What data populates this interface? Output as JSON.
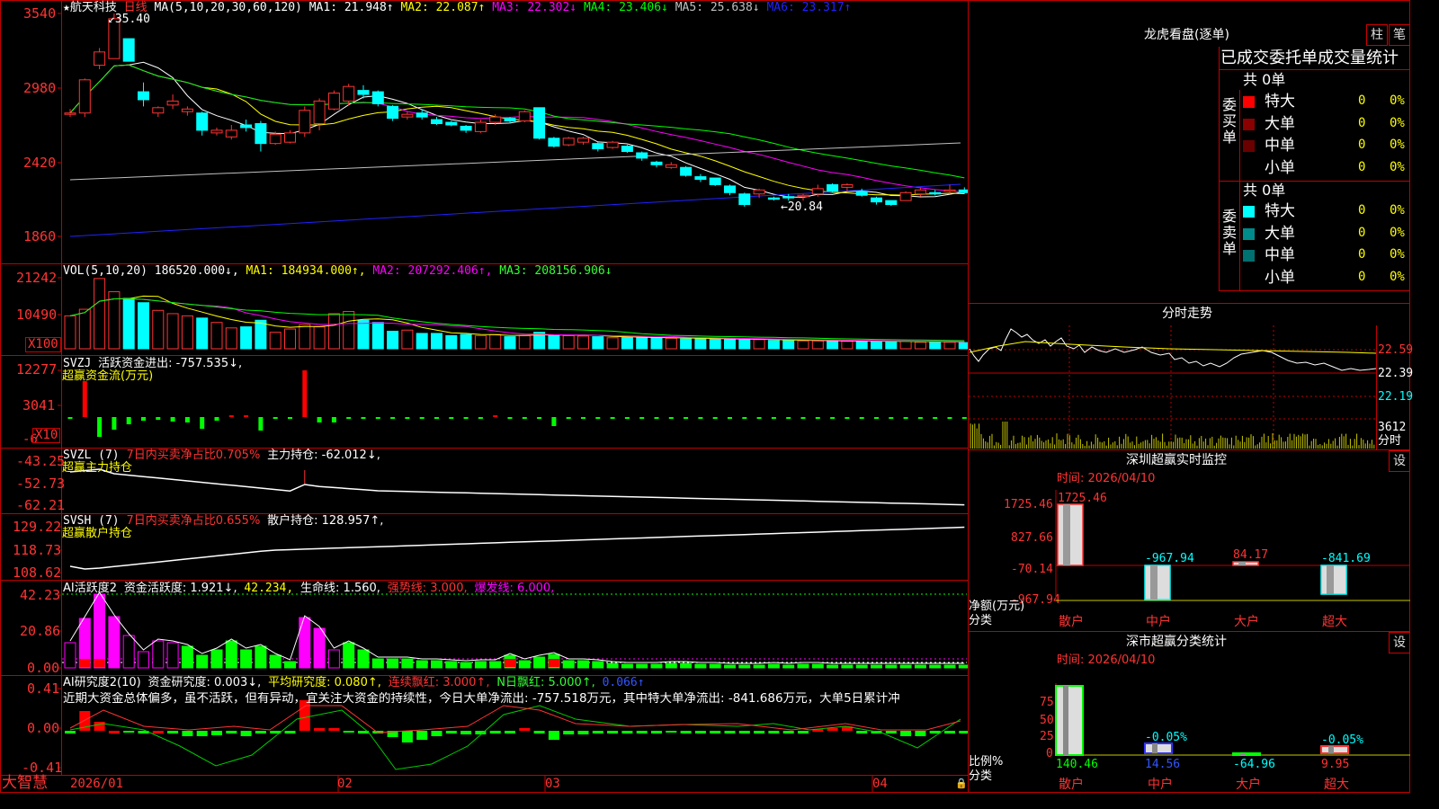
{
  "stock": {
    "name": "航天科技",
    "period": "日线",
    "ma_label": "MA(5,10,20,30,60,120)"
  },
  "ma_values": [
    {
      "label": "MA1: 21.948↑",
      "color": "#ffffff"
    },
    {
      "label": "MA2: 22.087↑",
      "color": "#ffff00"
    },
    {
      "label": "MA3: 22.302↓",
      "color": "#ff00ff"
    },
    {
      "label": "MA4: 23.406↓",
      "color": "#00ff00"
    },
    {
      "label": "MA5: 25.638↓",
      "color": "#c0c0c0"
    },
    {
      "label": "MA6: 23.317↑",
      "color": "#2222ff"
    }
  ],
  "price_axis": [
    "3540",
    "2980",
    "2420",
    "1860"
  ],
  "price_high_mark": "35.40",
  "price_low_mark": "←20.84",
  "vol": {
    "title": "VOL(5,10,20)",
    "value": "186520.000↓",
    "ma1": "MA1: 184934.000↑",
    "ma2": "MA2: 207292.406↑",
    "ma3": "MA3: 208156.906↓",
    "axis": [
      "21242",
      "10490"
    ],
    "unit": "X100"
  },
  "svzj": {
    "title": "SVZJ",
    "desc": "活跃资金进出: -757.535↓,",
    "subtitle": "超赢资金流(万元)",
    "axis": [
      "12277",
      "3041",
      "-6"
    ],
    "unit": "X10"
  },
  "svzl": {
    "title": "SVZL (7)",
    "desc_red": "7日内买卖净占比0.705%",
    "desc": "主力持仓: -62.012↓,",
    "subtitle": "超赢主力持仓",
    "axis": [
      "-43.25",
      "-52.73",
      "-62.21"
    ]
  },
  "svsh": {
    "title": "SVSH (7)",
    "desc_red": "7日内买卖净占比0.655%",
    "desc": "散户持仓: 128.957↑,",
    "subtitle": "超赢散户持仓",
    "axis": [
      "129.22",
      "118.73",
      "108.62"
    ]
  },
  "ai_active": {
    "title": "AI活跃度2",
    "active": "资金活跃度: 1.921↓,",
    "v2": "42.234,",
    "life": "生命线: 1.560,",
    "strong": "强势线: 3.000,",
    "burst": "爆发线: 6.000,",
    "axis": [
      "42.23",
      "20.86",
      "0.00"
    ]
  },
  "ai_research": {
    "title": "AI研究度2(10)",
    "research": "资金研究度: 0.003↓,",
    "avg": "平均研究度: 0.080↑,",
    "cont": "连续飘红: 3.000↑,",
    "nday": "N日飘红: 5.000↑,",
    "v5": "0.066↑",
    "axis": [
      "0.41",
      "0.00",
      "-0.41"
    ],
    "comment": "近期大资金总体偏多，虽不活跃，但有异动，宜关注大资金的持续性，今日大单净流出: -757.518万元，其中特大单净流出: -841.686万元，大单5日累计冲"
  },
  "dates": [
    "2026/01",
    "02",
    "03",
    "04"
  ],
  "brand": "大智慧",
  "lhb": {
    "title": "龙虎看盘(逐单)",
    "btn1": "柱",
    "btn2": "笔",
    "header": "已成交委托单成交量统计",
    "buy": {
      "side": "委买单",
      "total": "共 0单",
      "rows": [
        {
          "label": "特大",
          "qty": "0",
          "pct": "0%",
          "color": "#ff0000"
        },
        {
          "label": "大单",
          "qty": "0",
          "pct": "0%",
          "color": "#8b0000"
        },
        {
          "label": "中单",
          "qty": "0",
          "pct": "0%",
          "color": "#6b0000"
        },
        {
          "label": "小单",
          "qty": "0",
          "pct": "0%",
          "color": "#000000"
        }
      ]
    },
    "sell": {
      "side": "委卖单",
      "total": "共 0单",
      "rows": [
        {
          "label": "特大",
          "qty": "0",
          "pct": "0%",
          "color": "#00ffff"
        },
        {
          "label": "大单",
          "qty": "0",
          "pct": "0%",
          "color": "#008b8b"
        },
        {
          "label": "中单",
          "qty": "0",
          "pct": "0%",
          "color": "#007070"
        },
        {
          "label": "小单",
          "qty": "0",
          "pct": "0%",
          "color": "#000000"
        }
      ]
    }
  },
  "intraday": {
    "title": "分时走势",
    "axis": [
      "22.59",
      "22.39",
      "22.19"
    ],
    "vol": "3612",
    "unit": "分时"
  },
  "sz_monitor": {
    "title": "深圳超赢实时监控",
    "btn": "设",
    "time": "时间: 2026/04/10",
    "axis": [
      "1725.46",
      "827.66",
      "-70.14",
      "-967.94"
    ],
    "ylabel": "净额(万元)",
    "xlabel": "分类",
    "cats": [
      "散户",
      "中户",
      "大户",
      "超大"
    ],
    "values": [
      "1725.46",
      "-967.94",
      "84.17",
      "-841.69"
    ]
  },
  "sz_class": {
    "title": "深市超赢分类统计",
    "btn": "设",
    "time": "时间: 2026/04/10",
    "axis": [
      "75",
      "50",
      "25",
      "0"
    ],
    "ylabel": "比例%",
    "xlabel": "分类",
    "cats": [
      "散户",
      "中户",
      "大户",
      "超大"
    ],
    "pcts": [
      "",
      "-0.05%",
      "",
      "-0.05%"
    ],
    "values": [
      "140.46",
      "14.56",
      "-64.96",
      "9.95"
    ]
  },
  "chart_data": {
    "type": "candlestick",
    "title": "航天科技 日线",
    "candles": [
      [
        27.8,
        28.2,
        27.6,
        27.9
      ],
      [
        27.9,
        30.5,
        27.6,
        30.4
      ],
      [
        31.5,
        32.8,
        31.2,
        32.5
      ],
      [
        32.0,
        35.4,
        32.0,
        35.0
      ],
      [
        33.5,
        33.5,
        31.8,
        31.8
      ],
      [
        29.5,
        30.2,
        28.4,
        28.9
      ],
      [
        27.9,
        28.4,
        27.6,
        28.3
      ],
      [
        28.5,
        29.3,
        28.2,
        28.8
      ],
      [
        28.0,
        28.4,
        27.7,
        28.2
      ],
      [
        27.9,
        28.0,
        26.2,
        26.6
      ],
      [
        26.4,
        26.8,
        26.2,
        26.6
      ],
      [
        26.1,
        27.0,
        25.9,
        26.6
      ],
      [
        27.0,
        27.4,
        26.5,
        26.8
      ],
      [
        27.1,
        27.3,
        25.0,
        25.6
      ],
      [
        25.6,
        26.5,
        25.5,
        26.3
      ],
      [
        25.7,
        26.6,
        25.6,
        26.4
      ],
      [
        26.4,
        28.4,
        26.1,
        28.1
      ],
      [
        27.1,
        29.0,
        26.6,
        28.8
      ],
      [
        28.2,
        29.6,
        28.1,
        29.4
      ],
      [
        28.8,
        30.1,
        28.5,
        29.9
      ],
      [
        29.6,
        30.0,
        29.0,
        29.3
      ],
      [
        29.5,
        29.6,
        28.4,
        28.6
      ],
      [
        28.4,
        28.5,
        27.3,
        27.5
      ],
      [
        27.6,
        28.0,
        27.4,
        27.8
      ],
      [
        27.9,
        28.2,
        27.4,
        27.6
      ],
      [
        27.4,
        27.6,
        27.0,
        27.1
      ],
      [
        27.2,
        27.3,
        26.9,
        27.0
      ],
      [
        26.9,
        27.0,
        26.4,
        26.6
      ],
      [
        26.5,
        27.4,
        26.4,
        27.2
      ],
      [
        27.2,
        27.8,
        27.0,
        27.6
      ],
      [
        27.5,
        27.6,
        27.1,
        27.3
      ],
      [
        27.3,
        28.1,
        27.2,
        28.0
      ],
      [
        28.3,
        28.3,
        25.9,
        26.0
      ],
      [
        26.0,
        26.1,
        25.3,
        25.4
      ],
      [
        25.5,
        26.1,
        25.4,
        26.0
      ],
      [
        25.7,
        26.1,
        25.5,
        26.0
      ],
      [
        25.6,
        25.7,
        25.0,
        25.2
      ],
      [
        25.3,
        25.8,
        25.2,
        25.7
      ],
      [
        25.4,
        25.5,
        24.9,
        25.0
      ],
      [
        24.9,
        25.0,
        24.3,
        24.5
      ],
      [
        24.2,
        24.3,
        23.8,
        24.0
      ],
      [
        23.8,
        24.2,
        23.7,
        24.0
      ],
      [
        23.8,
        23.9,
        23.1,
        23.2
      ],
      [
        23.1,
        23.3,
        22.7,
        22.9
      ],
      [
        23.0,
        23.0,
        22.4,
        22.5
      ],
      [
        22.4,
        22.5,
        21.7,
        21.9
      ],
      [
        21.8,
        21.9,
        20.84,
        21.0
      ],
      [
        21.8,
        22.2,
        21.5,
        22.1
      ],
      [
        21.5,
        21.6,
        21.3,
        21.4
      ],
      [
        21.6,
        21.8,
        21.3,
        21.5
      ],
      [
        21.6,
        21.8,
        21.3,
        21.7
      ],
      [
        21.8,
        22.5,
        21.6,
        22.2
      ],
      [
        22.5,
        22.6,
        21.9,
        22.0
      ],
      [
        22.3,
        22.6,
        22.0,
        22.5
      ],
      [
        22.0,
        22.2,
        21.6,
        21.7
      ],
      [
        21.5,
        21.6,
        21.0,
        21.2
      ],
      [
        21.3,
        21.3,
        20.9,
        21.0
      ],
      [
        21.3,
        22.0,
        21.3,
        21.9
      ],
      [
        21.8,
        22.3,
        21.6,
        22.1
      ],
      [
        21.9,
        22.1,
        21.7,
        21.8
      ],
      [
        22.0,
        22.5,
        21.8,
        22.1
      ],
      [
        22.1,
        22.3,
        21.8,
        21.9
      ]
    ],
    "volume": [
      150,
      180,
      320,
      260,
      230,
      210,
      175,
      160,
      150,
      140,
      120,
      95,
      100,
      130,
      75,
      90,
      110,
      100,
      160,
      170,
      130,
      120,
      80,
      85,
      70,
      70,
      60,
      65,
      60,
      65,
      55,
      60,
      75,
      60,
      60,
      58,
      55,
      50,
      52,
      50,
      50,
      48,
      45,
      46,
      44,
      45,
      40,
      42,
      38,
      38,
      36,
      36,
      36,
      35,
      34,
      33,
      32,
      35,
      30,
      32,
      30,
      28
    ],
    "ylim": [
      18.6,
      35.4
    ]
  }
}
